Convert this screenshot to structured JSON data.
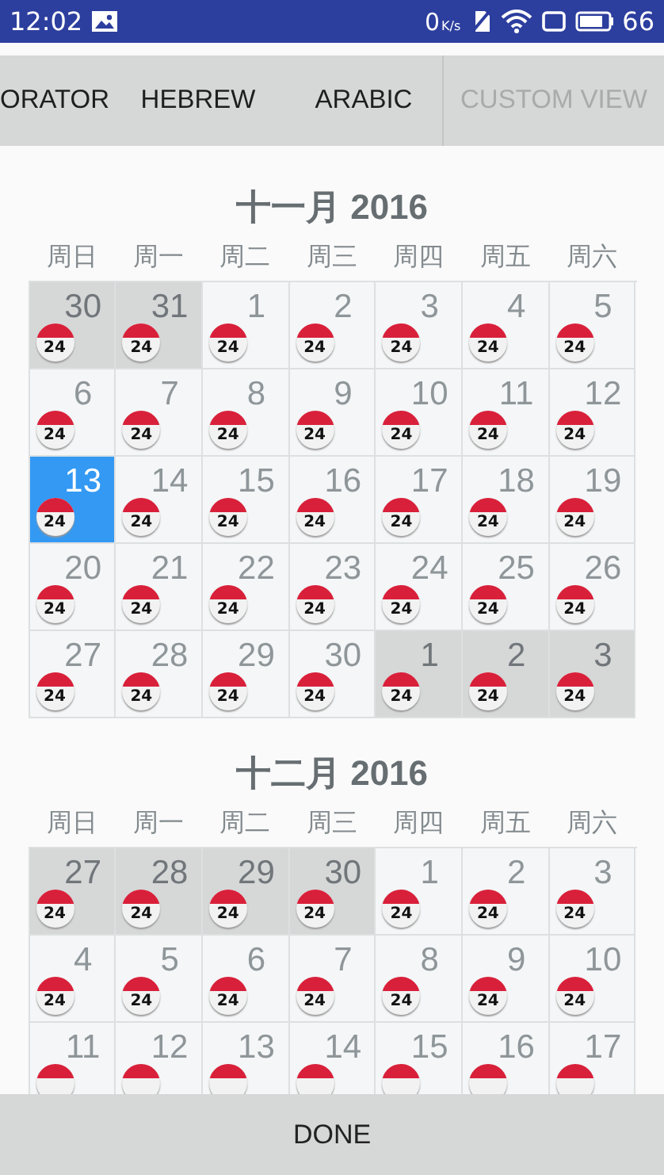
{
  "status_bar": {
    "time": "12:02",
    "network_speed": "0",
    "speed_unit": "K/s",
    "battery": "66"
  },
  "tabs": [
    {
      "label": "ORATOR",
      "disabled": false
    },
    {
      "label": "HEBREW",
      "disabled": false
    },
    {
      "label": "ARABIC",
      "disabled": false
    },
    {
      "label": "CUSTOM VIEW",
      "disabled": true
    }
  ],
  "months": [
    {
      "title": "十一月 2016",
      "weekdays": [
        "周日",
        "周一",
        "周二",
        "周三",
        "周四",
        "周五",
        "周六"
      ],
      "weeks": [
        [
          {
            "day": "30",
            "badge": "24",
            "other_month": true,
            "selected": false
          },
          {
            "day": "31",
            "badge": "24",
            "other_month": true,
            "selected": false
          },
          {
            "day": "1",
            "badge": "24",
            "other_month": false,
            "selected": false
          },
          {
            "day": "2",
            "badge": "24",
            "other_month": false,
            "selected": false
          },
          {
            "day": "3",
            "badge": "24",
            "other_month": false,
            "selected": false
          },
          {
            "day": "4",
            "badge": "24",
            "other_month": false,
            "selected": false
          },
          {
            "day": "5",
            "badge": "24",
            "other_month": false,
            "selected": false
          }
        ],
        [
          {
            "day": "6",
            "badge": "24",
            "other_month": false,
            "selected": false
          },
          {
            "day": "7",
            "badge": "24",
            "other_month": false,
            "selected": false
          },
          {
            "day": "8",
            "badge": "24",
            "other_month": false,
            "selected": false
          },
          {
            "day": "9",
            "badge": "24",
            "other_month": false,
            "selected": false
          },
          {
            "day": "10",
            "badge": "24",
            "other_month": false,
            "selected": false
          },
          {
            "day": "11",
            "badge": "24",
            "other_month": false,
            "selected": false
          },
          {
            "day": "12",
            "badge": "24",
            "other_month": false,
            "selected": false
          }
        ],
        [
          {
            "day": "13",
            "badge": "24",
            "other_month": false,
            "selected": true
          },
          {
            "day": "14",
            "badge": "24",
            "other_month": false,
            "selected": false
          },
          {
            "day": "15",
            "badge": "24",
            "other_month": false,
            "selected": false
          },
          {
            "day": "16",
            "badge": "24",
            "other_month": false,
            "selected": false
          },
          {
            "day": "17",
            "badge": "24",
            "other_month": false,
            "selected": false
          },
          {
            "day": "18",
            "badge": "24",
            "other_month": false,
            "selected": false
          },
          {
            "day": "19",
            "badge": "24",
            "other_month": false,
            "selected": false
          }
        ],
        [
          {
            "day": "20",
            "badge": "24",
            "other_month": false,
            "selected": false
          },
          {
            "day": "21",
            "badge": "24",
            "other_month": false,
            "selected": false
          },
          {
            "day": "22",
            "badge": "24",
            "other_month": false,
            "selected": false
          },
          {
            "day": "23",
            "badge": "24",
            "other_month": false,
            "selected": false
          },
          {
            "day": "24",
            "badge": "24",
            "other_month": false,
            "selected": false
          },
          {
            "day": "25",
            "badge": "24",
            "other_month": false,
            "selected": false
          },
          {
            "day": "26",
            "badge": "24",
            "other_month": false,
            "selected": false
          }
        ],
        [
          {
            "day": "27",
            "badge": "24",
            "other_month": false,
            "selected": false
          },
          {
            "day": "28",
            "badge": "24",
            "other_month": false,
            "selected": false
          },
          {
            "day": "29",
            "badge": "24",
            "other_month": false,
            "selected": false
          },
          {
            "day": "30",
            "badge": "24",
            "other_month": false,
            "selected": false
          },
          {
            "day": "1",
            "badge": "24",
            "other_month": true,
            "selected": false
          },
          {
            "day": "2",
            "badge": "24",
            "other_month": true,
            "selected": false
          },
          {
            "day": "3",
            "badge": "24",
            "other_month": true,
            "selected": false
          }
        ]
      ]
    },
    {
      "title": "十二月 2016",
      "weekdays": [
        "周日",
        "周一",
        "周二",
        "周三",
        "周四",
        "周五",
        "周六"
      ],
      "weeks": [
        [
          {
            "day": "27",
            "badge": "24",
            "other_month": true,
            "selected": false
          },
          {
            "day": "28",
            "badge": "24",
            "other_month": true,
            "selected": false
          },
          {
            "day": "29",
            "badge": "24",
            "other_month": true,
            "selected": false
          },
          {
            "day": "30",
            "badge": "24",
            "other_month": true,
            "selected": false
          },
          {
            "day": "1",
            "badge": "24",
            "other_month": false,
            "selected": false
          },
          {
            "day": "2",
            "badge": "24",
            "other_month": false,
            "selected": false
          },
          {
            "day": "3",
            "badge": "24",
            "other_month": false,
            "selected": false
          }
        ],
        [
          {
            "day": "4",
            "badge": "24",
            "other_month": false,
            "selected": false
          },
          {
            "day": "5",
            "badge": "24",
            "other_month": false,
            "selected": false
          },
          {
            "day": "6",
            "badge": "24",
            "other_month": false,
            "selected": false
          },
          {
            "day": "7",
            "badge": "24",
            "other_month": false,
            "selected": false
          },
          {
            "day": "8",
            "badge": "24",
            "other_month": false,
            "selected": false
          },
          {
            "day": "9",
            "badge": "24",
            "other_month": false,
            "selected": false
          },
          {
            "day": "10",
            "badge": "24",
            "other_month": false,
            "selected": false
          }
        ],
        [
          {
            "day": "11",
            "other_month": false,
            "selected": false
          },
          {
            "day": "12",
            "other_month": false,
            "selected": false
          },
          {
            "day": "13",
            "other_month": false,
            "selected": false
          },
          {
            "day": "14",
            "other_month": false,
            "selected": false
          },
          {
            "day": "15",
            "other_month": false,
            "selected": false
          },
          {
            "day": "16",
            "other_month": false,
            "selected": false
          },
          {
            "day": "17",
            "other_month": false,
            "selected": false
          }
        ]
      ]
    }
  ],
  "done_button": "DONE"
}
